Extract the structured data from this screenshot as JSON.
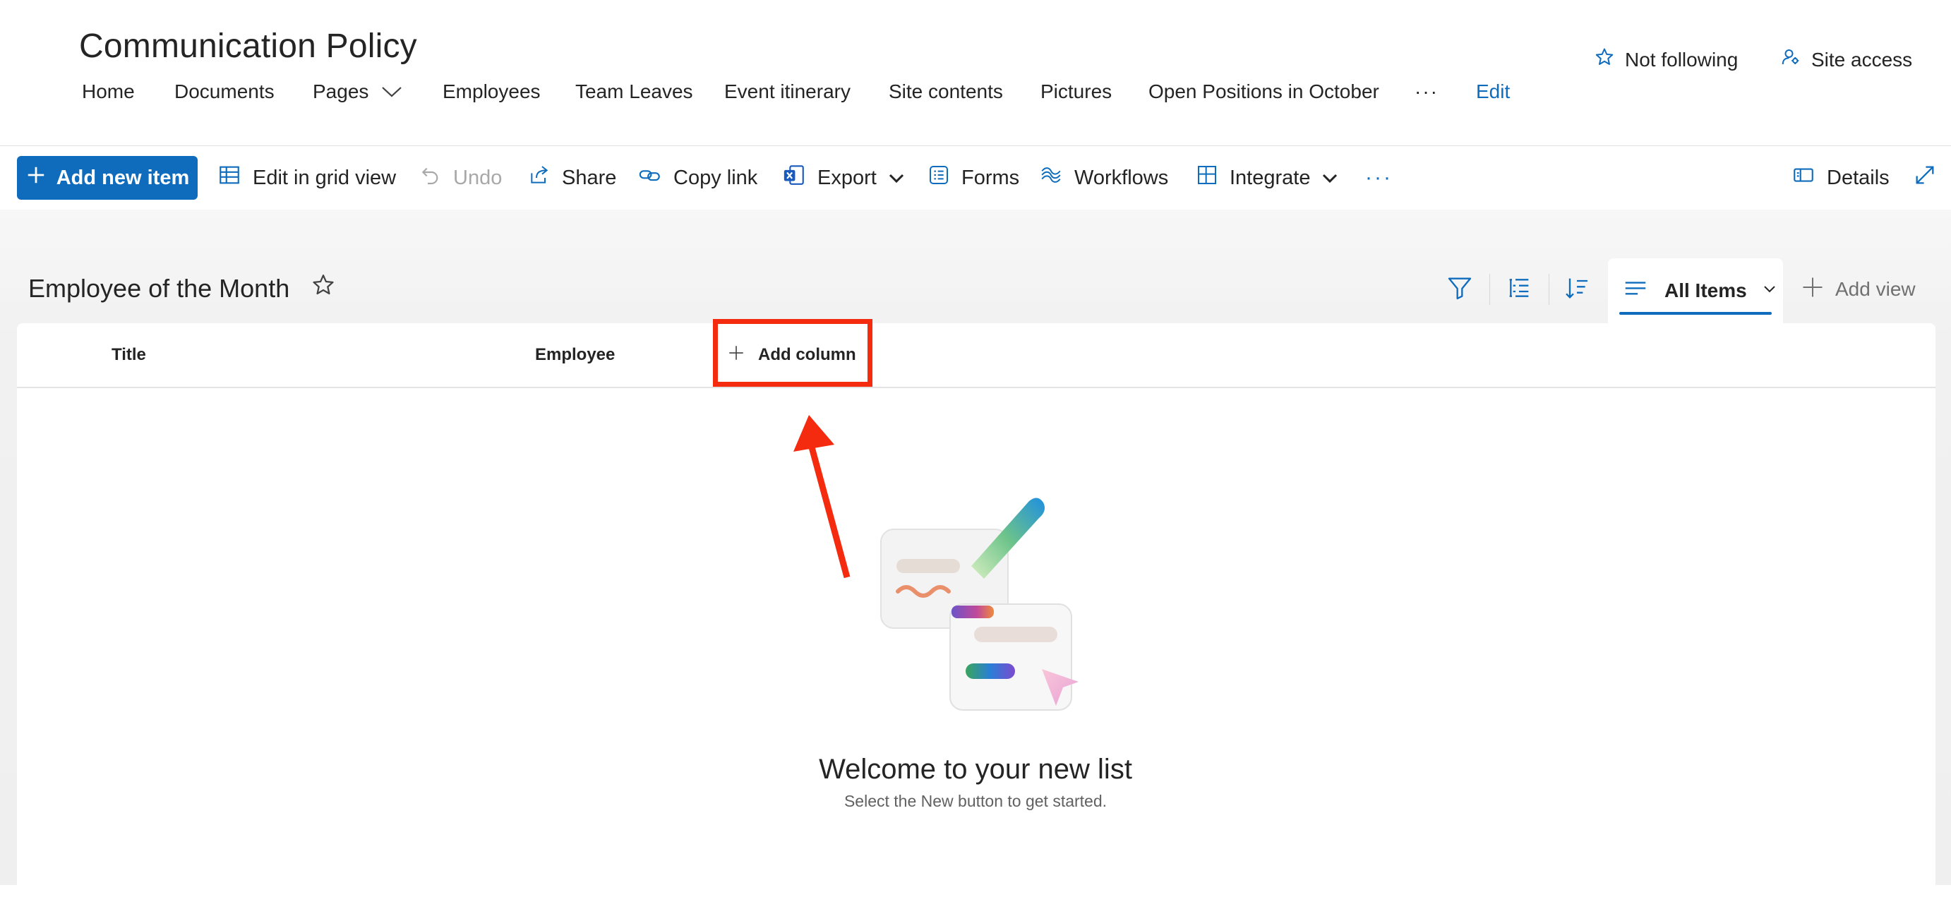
{
  "site": {
    "title": "Communication Policy",
    "nav": {
      "home": "Home",
      "documents": "Documents",
      "pages": "Pages",
      "employees": "Employees",
      "team_leaves": "Team Leaves",
      "event_itinerary": "Event itinerary",
      "site_contents": "Site contents",
      "pictures": "Pictures",
      "open_positions": "Open Positions in October",
      "more": "···",
      "edit": "Edit"
    },
    "not_following": "Not following",
    "site_access": "Site access"
  },
  "toolbar": {
    "add_new_item": "Add new item",
    "edit_grid": "Edit in grid view",
    "undo": "Undo",
    "share": "Share",
    "copy_link": "Copy link",
    "export": "Export",
    "forms": "Forms",
    "workflows": "Workflows",
    "integrate": "Integrate",
    "more": "···",
    "details": "Details"
  },
  "list": {
    "title": "Employee of the Month",
    "view_name": "All Items",
    "add_view": "Add view",
    "columns": {
      "title": "Title",
      "employee": "Employee",
      "add_column": "Add column"
    },
    "empty": {
      "title": "Welcome to your new list",
      "subtitle": "Select the New button to get started."
    }
  },
  "colors": {
    "accent": "#0f6cbd",
    "annotation": "#f42b0f"
  },
  "icons": [
    "star-outline-icon",
    "site-access-icon",
    "chevron-down-icon",
    "plus-icon",
    "grid-icon",
    "undo-icon",
    "share-icon",
    "link-icon",
    "excel-icon",
    "forms-icon",
    "workflows-icon",
    "integrate-icon",
    "details-icon",
    "expand-icon",
    "filter-icon",
    "group-icon",
    "sort-icon",
    "view-lines-icon"
  ]
}
